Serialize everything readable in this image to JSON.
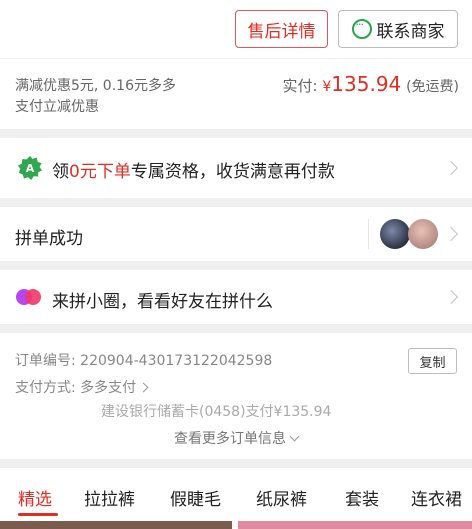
{
  "actions": {
    "after_sales_label": "售后详情",
    "contact_label": "联系商家"
  },
  "payment": {
    "discount_line1": "满减优惠5元, 0.16元多多",
    "discount_line2": "支付立减优惠",
    "paid_label": "实付:",
    "currency": "¥",
    "amount": "135.94",
    "shipping": "(免运费)"
  },
  "zero_offer": {
    "badge": "A",
    "prefix": "领",
    "highlight": "0元下单",
    "suffix": "专属资格，收货满意再付款"
  },
  "group": {
    "title": "拼单成功"
  },
  "circle": {
    "text": "来拼小圈，看看好友在拼什么"
  },
  "order": {
    "number_label": "订单编号:",
    "number_value": "220904-430173122042598",
    "copy_label": "复制",
    "pay_method_label": "支付方式:",
    "pay_method_value": "多多支付",
    "bank_line": "建设银行储蓄卡(0458)支付¥135.94",
    "more_label": "查看更多订单信息"
  },
  "tabs": [
    {
      "label": "精选"
    },
    {
      "label": "拉拉裤"
    },
    {
      "label": "假睫毛"
    },
    {
      "label": "纸尿裤"
    },
    {
      "label": "套装"
    },
    {
      "label": "连衣裙"
    }
  ],
  "colors": {
    "accent_red": "#e02e24",
    "wechat_green": "#2aa44b"
  }
}
